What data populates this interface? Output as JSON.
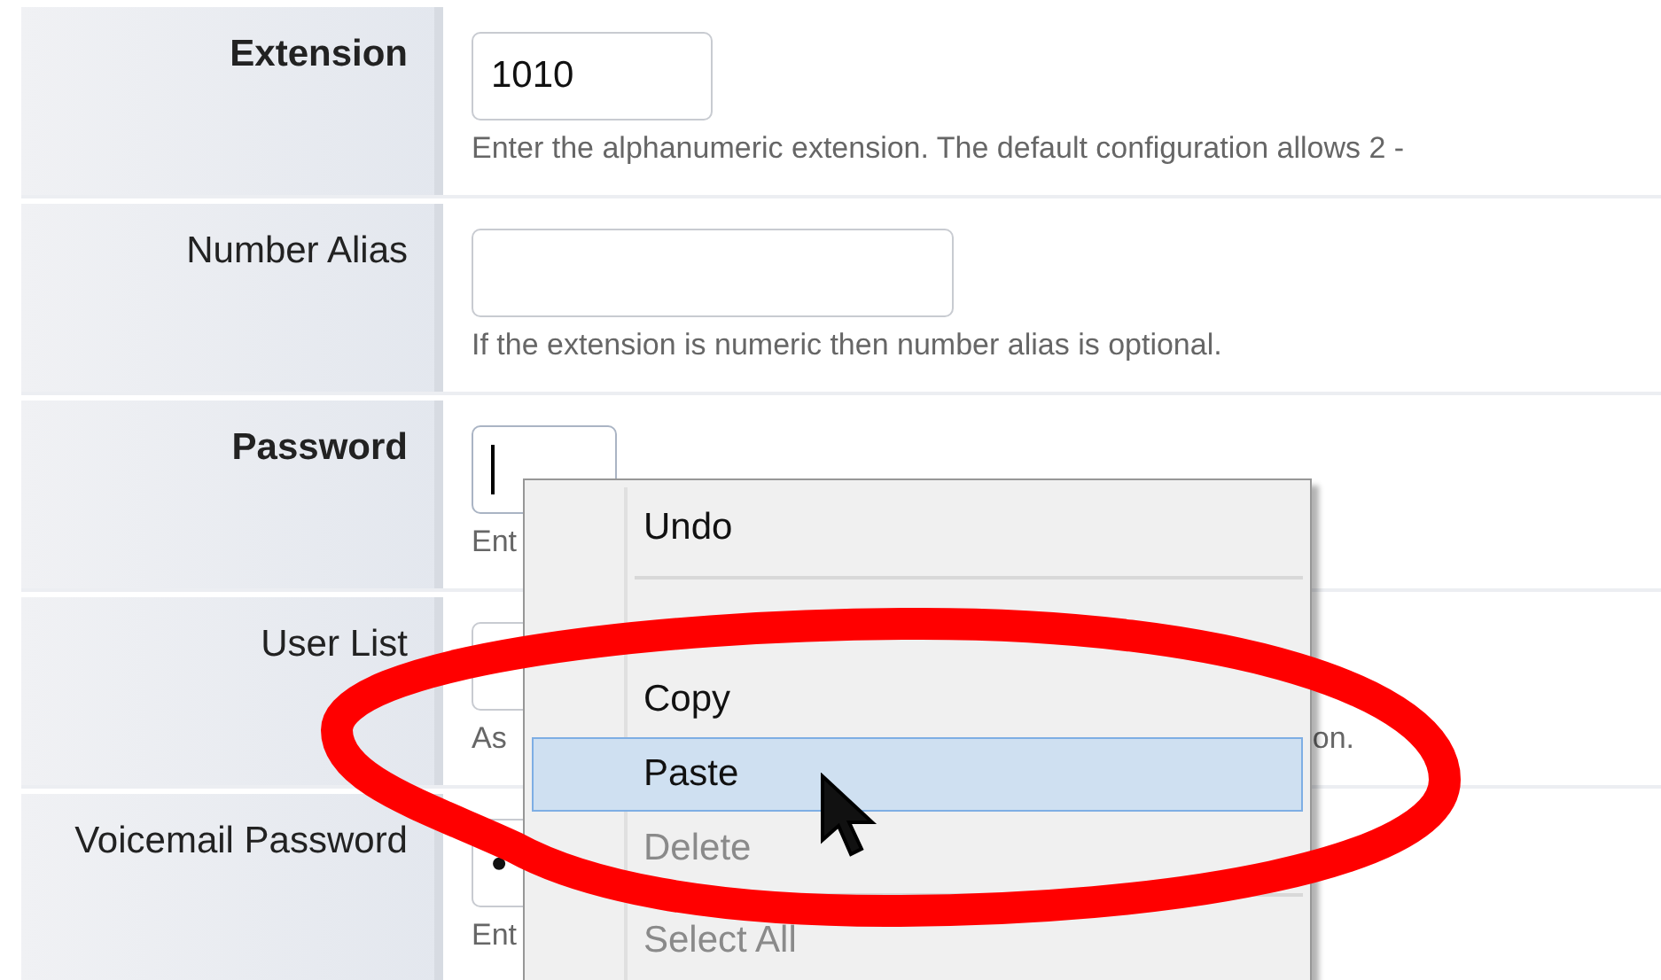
{
  "form_rows": [
    {
      "label": "Extension",
      "bold": true,
      "kind": "text",
      "value": "1010",
      "focused": false,
      "hint": "Enter the alphanumeric extension. The default configuration allows 2 -"
    },
    {
      "label": "Number Alias",
      "bold": false,
      "kind": "text",
      "value": "",
      "focused": false,
      "hint": "If the extension is numeric then number alias is optional."
    },
    {
      "label": "Password",
      "bold": true,
      "kind": "text",
      "value": "",
      "focused": true,
      "hint": "Ent"
    },
    {
      "label": "User List",
      "bold": false,
      "kind": "text",
      "value": "",
      "focused": false,
      "hint": "As",
      "hint_end": "on."
    },
    {
      "label": "Voicemail Password",
      "bold": false,
      "kind": "password",
      "value": "•",
      "focused": false,
      "hint": "Ent"
    }
  ],
  "context_menu": {
    "items": [
      {
        "kind": "item",
        "label": "Undo",
        "selected": false,
        "disabled": false
      },
      {
        "kind": "separator"
      },
      {
        "kind": "gap"
      },
      {
        "kind": "item",
        "label": "Copy",
        "selected": false,
        "disabled": false
      },
      {
        "kind": "item",
        "label": "Paste",
        "selected": true,
        "disabled": false
      },
      {
        "kind": "item",
        "label": "Delete",
        "selected": false,
        "disabled": true
      },
      {
        "kind": "separator"
      },
      {
        "kind": "item",
        "label": "Select All",
        "selected": false,
        "disabled": true
      }
    ]
  }
}
